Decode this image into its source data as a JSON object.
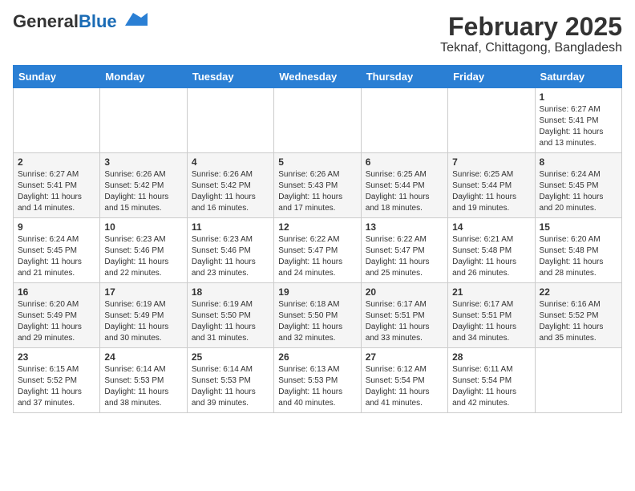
{
  "header": {
    "logo_general": "General",
    "logo_blue": "Blue",
    "title": "February 2025",
    "subtitle": "Teknaf, Chittagong, Bangladesh"
  },
  "weekdays": [
    "Sunday",
    "Monday",
    "Tuesday",
    "Wednesday",
    "Thursday",
    "Friday",
    "Saturday"
  ],
  "weeks": [
    [
      {
        "day": "",
        "info": ""
      },
      {
        "day": "",
        "info": ""
      },
      {
        "day": "",
        "info": ""
      },
      {
        "day": "",
        "info": ""
      },
      {
        "day": "",
        "info": ""
      },
      {
        "day": "",
        "info": ""
      },
      {
        "day": "1",
        "info": "Sunrise: 6:27 AM\nSunset: 5:41 PM\nDaylight: 11 hours\nand 13 minutes."
      }
    ],
    [
      {
        "day": "2",
        "info": "Sunrise: 6:27 AM\nSunset: 5:41 PM\nDaylight: 11 hours\nand 14 minutes."
      },
      {
        "day": "3",
        "info": "Sunrise: 6:26 AM\nSunset: 5:42 PM\nDaylight: 11 hours\nand 15 minutes."
      },
      {
        "day": "4",
        "info": "Sunrise: 6:26 AM\nSunset: 5:42 PM\nDaylight: 11 hours\nand 16 minutes."
      },
      {
        "day": "5",
        "info": "Sunrise: 6:26 AM\nSunset: 5:43 PM\nDaylight: 11 hours\nand 17 minutes."
      },
      {
        "day": "6",
        "info": "Sunrise: 6:25 AM\nSunset: 5:44 PM\nDaylight: 11 hours\nand 18 minutes."
      },
      {
        "day": "7",
        "info": "Sunrise: 6:25 AM\nSunset: 5:44 PM\nDaylight: 11 hours\nand 19 minutes."
      },
      {
        "day": "8",
        "info": "Sunrise: 6:24 AM\nSunset: 5:45 PM\nDaylight: 11 hours\nand 20 minutes."
      }
    ],
    [
      {
        "day": "9",
        "info": "Sunrise: 6:24 AM\nSunset: 5:45 PM\nDaylight: 11 hours\nand 21 minutes."
      },
      {
        "day": "10",
        "info": "Sunrise: 6:23 AM\nSunset: 5:46 PM\nDaylight: 11 hours\nand 22 minutes."
      },
      {
        "day": "11",
        "info": "Sunrise: 6:23 AM\nSunset: 5:46 PM\nDaylight: 11 hours\nand 23 minutes."
      },
      {
        "day": "12",
        "info": "Sunrise: 6:22 AM\nSunset: 5:47 PM\nDaylight: 11 hours\nand 24 minutes."
      },
      {
        "day": "13",
        "info": "Sunrise: 6:22 AM\nSunset: 5:47 PM\nDaylight: 11 hours\nand 25 minutes."
      },
      {
        "day": "14",
        "info": "Sunrise: 6:21 AM\nSunset: 5:48 PM\nDaylight: 11 hours\nand 26 minutes."
      },
      {
        "day": "15",
        "info": "Sunrise: 6:20 AM\nSunset: 5:48 PM\nDaylight: 11 hours\nand 28 minutes."
      }
    ],
    [
      {
        "day": "16",
        "info": "Sunrise: 6:20 AM\nSunset: 5:49 PM\nDaylight: 11 hours\nand 29 minutes."
      },
      {
        "day": "17",
        "info": "Sunrise: 6:19 AM\nSunset: 5:49 PM\nDaylight: 11 hours\nand 30 minutes."
      },
      {
        "day": "18",
        "info": "Sunrise: 6:19 AM\nSunset: 5:50 PM\nDaylight: 11 hours\nand 31 minutes."
      },
      {
        "day": "19",
        "info": "Sunrise: 6:18 AM\nSunset: 5:50 PM\nDaylight: 11 hours\nand 32 minutes."
      },
      {
        "day": "20",
        "info": "Sunrise: 6:17 AM\nSunset: 5:51 PM\nDaylight: 11 hours\nand 33 minutes."
      },
      {
        "day": "21",
        "info": "Sunrise: 6:17 AM\nSunset: 5:51 PM\nDaylight: 11 hours\nand 34 minutes."
      },
      {
        "day": "22",
        "info": "Sunrise: 6:16 AM\nSunset: 5:52 PM\nDaylight: 11 hours\nand 35 minutes."
      }
    ],
    [
      {
        "day": "23",
        "info": "Sunrise: 6:15 AM\nSunset: 5:52 PM\nDaylight: 11 hours\nand 37 minutes."
      },
      {
        "day": "24",
        "info": "Sunrise: 6:14 AM\nSunset: 5:53 PM\nDaylight: 11 hours\nand 38 minutes."
      },
      {
        "day": "25",
        "info": "Sunrise: 6:14 AM\nSunset: 5:53 PM\nDaylight: 11 hours\nand 39 minutes."
      },
      {
        "day": "26",
        "info": "Sunrise: 6:13 AM\nSunset: 5:53 PM\nDaylight: 11 hours\nand 40 minutes."
      },
      {
        "day": "27",
        "info": "Sunrise: 6:12 AM\nSunset: 5:54 PM\nDaylight: 11 hours\nand 41 minutes."
      },
      {
        "day": "28",
        "info": "Sunrise: 6:11 AM\nSunset: 5:54 PM\nDaylight: 11 hours\nand 42 minutes."
      },
      {
        "day": "",
        "info": ""
      }
    ]
  ]
}
